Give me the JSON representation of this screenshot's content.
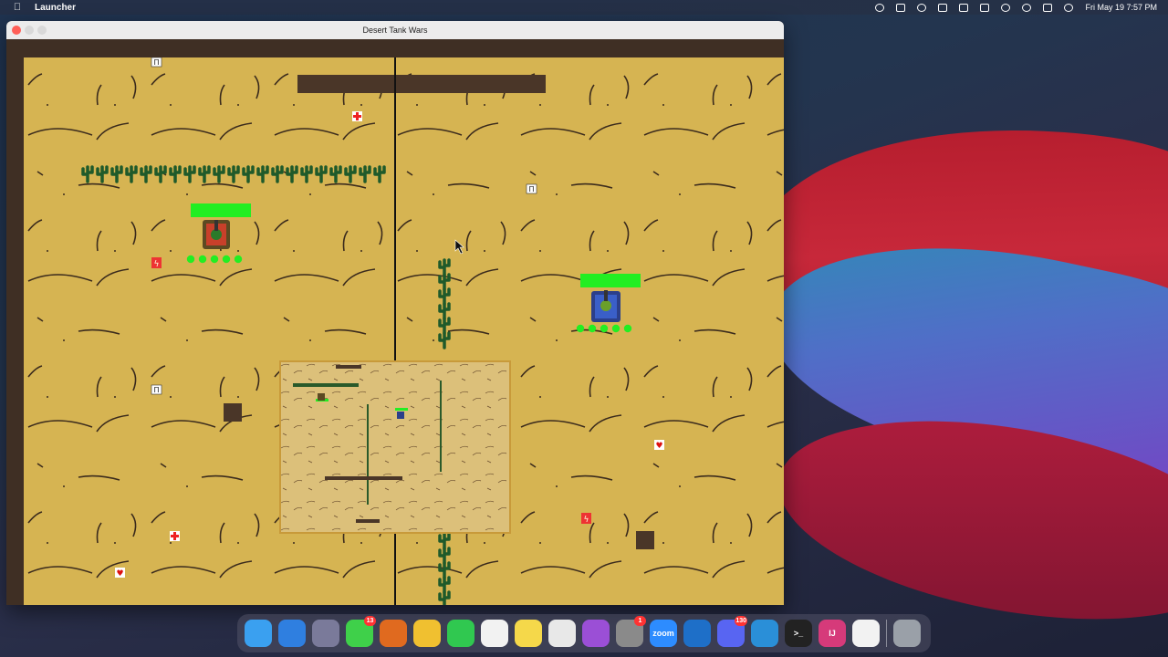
{
  "menubar": {
    "app_name": "Launcher",
    "clock": "Fri May 19  7:57 PM"
  },
  "window": {
    "title": "Desert Tank Wars"
  },
  "game": {
    "colors": {
      "sand": "#d6b452",
      "wall": "#4a3628",
      "cactus": "#1f5a2a",
      "health_bar": "#22ee22",
      "divider": "#111111"
    },
    "player1": {
      "name": "red-tank",
      "health": 1.0,
      "lives": 5
    },
    "player2": {
      "name": "blue-tank",
      "health": 1.0,
      "lives": 5
    },
    "powerups": [
      "shield",
      "health-kit",
      "speed",
      "extra-life"
    ]
  },
  "dock": {
    "apps": [
      {
        "name": "finder-icon",
        "color": "#3aa0f0",
        "label": ""
      },
      {
        "name": "safari-icon",
        "color": "#2f7fe0",
        "label": ""
      },
      {
        "name": "launchpad-icon",
        "color": "#7a7a9a",
        "label": ""
      },
      {
        "name": "messages-icon",
        "color": "#3fd04a",
        "label": "",
        "badge": "13"
      },
      {
        "name": "firefox-icon",
        "color": "#e06a1f",
        "label": ""
      },
      {
        "name": "photos-icon",
        "color": "#f0c030",
        "label": ""
      },
      {
        "name": "facetime-icon",
        "color": "#30c850",
        "label": ""
      },
      {
        "name": "reminders-icon",
        "color": "#f2f2f2",
        "label": ""
      },
      {
        "name": "notes-icon",
        "color": "#f5d84a",
        "label": ""
      },
      {
        "name": "chrome-icon",
        "color": "#e8e8e8",
        "label": ""
      },
      {
        "name": "podcasts-icon",
        "color": "#9b4fd6",
        "label": ""
      },
      {
        "name": "system-preferences-icon",
        "color": "#8a8a8a",
        "label": "",
        "badge": "1"
      },
      {
        "name": "zoom-icon",
        "color": "#2d8cff",
        "label": "zoom"
      },
      {
        "name": "outlook-icon",
        "color": "#1e6fc8",
        "label": ""
      },
      {
        "name": "discord-icon",
        "color": "#5865f2",
        "label": "",
        "badge": "130"
      },
      {
        "name": "vscode-icon",
        "color": "#2a8fd8",
        "label": ""
      },
      {
        "name": "terminal-icon",
        "color": "#222222",
        "label": ">_"
      },
      {
        "name": "intellij-icon",
        "color": "#d63a7a",
        "label": "IJ"
      },
      {
        "name": "java-icon",
        "color": "#f2f2f2",
        "label": ""
      },
      {
        "name": "trash-icon",
        "color": "#9aa0a8",
        "label": ""
      }
    ]
  }
}
